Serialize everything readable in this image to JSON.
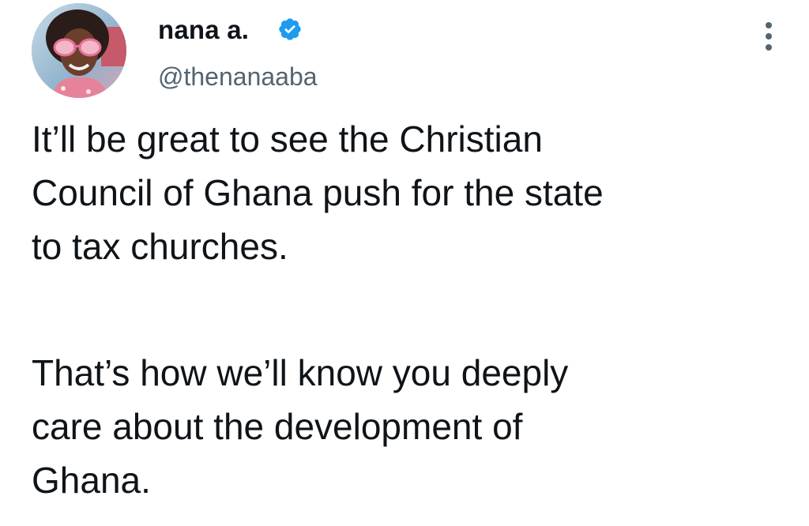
{
  "author": {
    "display_name": "nana a.",
    "handle": "@thenanaaba",
    "verified": true,
    "verified_badge_color": "#1d9bf0"
  },
  "menu": {
    "icon": "more-vertical-icon"
  },
  "tweet": {
    "paragraph_1": [
      "It’ll be great to see the Christian",
      "Council of Ghana push for the state",
      "to tax churches."
    ],
    "paragraph_2": [
      "That’s how we’ll know you deeply",
      "care about the development of",
      "Ghana."
    ]
  }
}
